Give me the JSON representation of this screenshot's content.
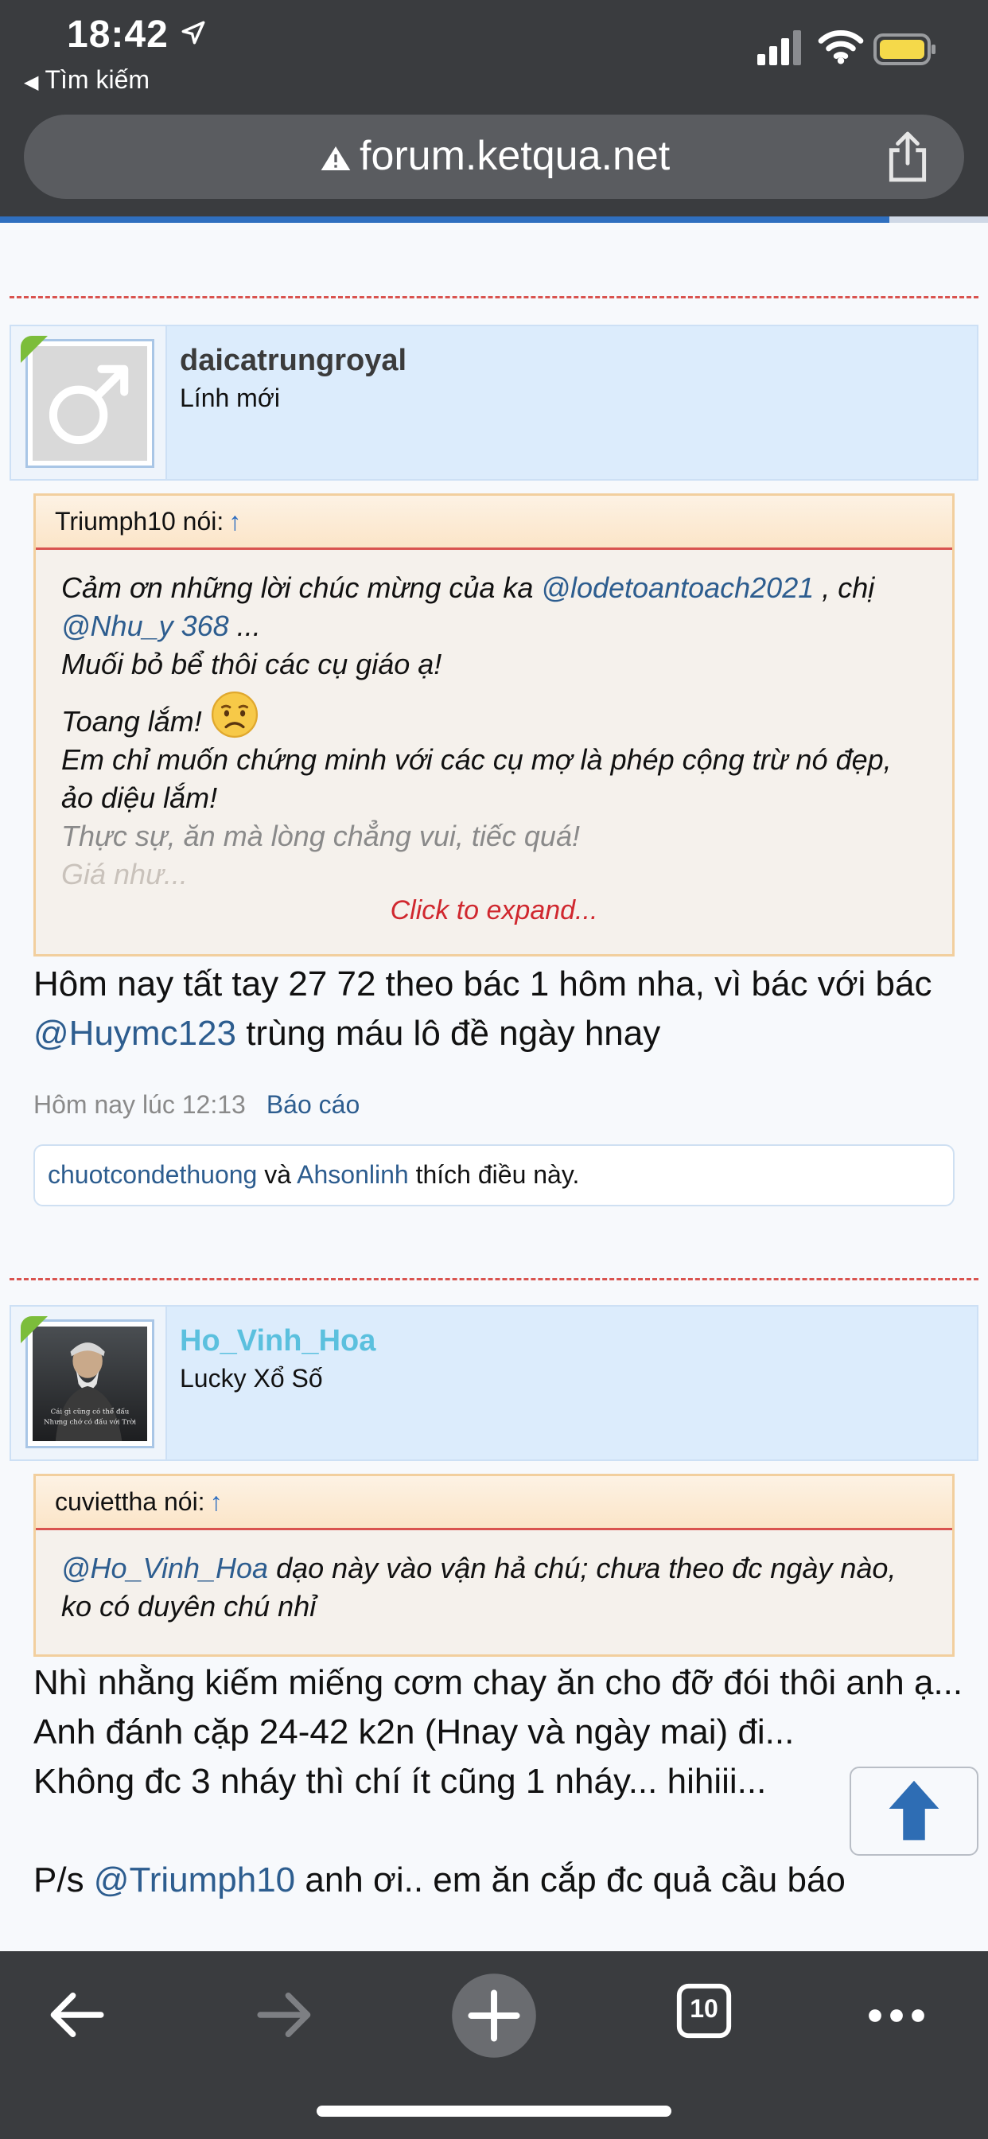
{
  "status_bar": {
    "time": "18:42",
    "back_app": "Tìm kiếm",
    "battery_color": "#f5d94a"
  },
  "browser": {
    "url": "forum.ketqua.net",
    "load_progress": 0.9,
    "tab_count": "10"
  },
  "posts": [
    {
      "username": "daicatrungroyal",
      "username_color": "#3b3b3b",
      "user_title": "Lính mới",
      "quote": {
        "author": "Triumph10 nói:",
        "up_arrow": "↑",
        "l1_a": "Cảm ơn những lời chúc mừng của ka ",
        "l1_mention": "@lodetoantoach2021",
        "l1_b": " , chị",
        "l2_mention": "@Nhu_y 368",
        "l2_b": " ...",
        "l3": "Muối bỏ bể thôi các cụ giáo ạ!",
        "l4": "Toang lắm!",
        "l5": "Em chỉ muốn chứng minh với các cụ mợ là phép cộng trừ nó đẹp, ảo diệu lắm!",
        "l6": "Thực sự, ăn mà lòng chẳng vui, tiếc quá!",
        "l7": "Giá như...",
        "expand": "Click to expand..."
      },
      "body_a": "Hôm nay tất tay 27 72 theo bác 1 hôm nha, vì bác với bác ",
      "body_mention": "@Huymc123",
      "body_b": " trùng máu lô đề ngày hnay",
      "timestamp": "Hôm nay lúc 12:13",
      "report": "Báo cáo",
      "likes": {
        "user1": "chuotcondethuong",
        "and": " và ",
        "user2": "Ahsonlinh",
        "suffix": " thích điều này."
      }
    },
    {
      "username": "Ho_Vinh_Hoa",
      "username_color": "#5bc0de",
      "user_title": "Lucky Xổ Số",
      "avatar_caption_1": "Cái gì cũng có thể đấu",
      "avatar_caption_2": "Nhưng chớ có đấu với Trời",
      "quote": {
        "author": "cuviettha nói:",
        "up_arrow": "↑",
        "mention": "@Ho_Vinh_Hoa",
        "text": " dạo này vào vận hả chú; chưa theo đc ngày nào, ko có duyên chú nhỉ"
      },
      "body_l1": "Nhì nhằng kiếm miếng cơm chay ăn cho đỡ đói thôi anh ạ...",
      "body_l2": "Anh đánh cặp 24-42 k2n (Hnay và ngày mai) đi...",
      "body_l3": "Không đc 3 nháy thì chí ít cũng 1 nháy... hihiii...",
      "body_l4_a": "P/s ",
      "body_l4_mention": "@Triumph10",
      "body_l4_b": " anh ơi.. em ăn cắp đc quả cầu báo"
    }
  ],
  "icons": {
    "location": "location-arrow-icon",
    "signal": "cellular-signal-icon",
    "wifi": "wifi-icon",
    "battery": "battery-icon",
    "warning": "not-secure-warning-icon",
    "share": "share-icon",
    "back": "back-arrow-icon",
    "forward": "forward-arrow-icon",
    "new_tab": "plus-icon",
    "tabs": "tabs-icon",
    "more": "more-icon",
    "scroll_top": "scroll-top-arrow-icon"
  },
  "colors": {
    "link": "#2d5d8f",
    "separator": "#d9534f",
    "expand": "#d0282f"
  }
}
